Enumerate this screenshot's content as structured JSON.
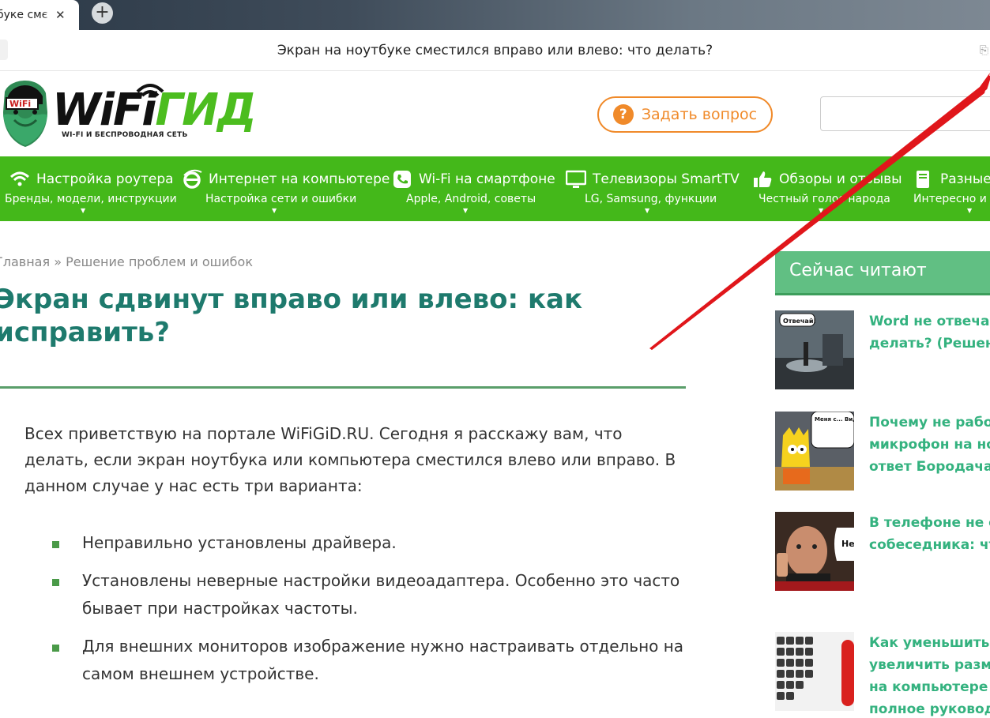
{
  "browser": {
    "tab_title": "букe смє",
    "tab_close": "✕",
    "new_tab": "+",
    "page_title": "Экран на ноутбуке сместился вправо или влево: что делать?"
  },
  "header": {
    "logo_main_black": "WiFi",
    "logo_main_green": "ГИД",
    "logo_badge": "WiFi",
    "logo_tagline": "WI-FI И БЕСПРОВОДНАЯ СЕТЬ",
    "ask_label": "Задать вопрос",
    "ask_icon": "?"
  },
  "nav": [
    {
      "title": "Настройка роутера",
      "sub": "Бренды, модели, инструкции",
      "icon": "wifi-icon"
    },
    {
      "title": "Интернет на компьютере",
      "sub": "Настройка сети и ошибки",
      "icon": "ie-icon"
    },
    {
      "title": "Wi-Fi на смартфоне",
      "sub": "Apple, Android, советы",
      "icon": "phone-icon"
    },
    {
      "title": "Телевизоры SmartTV",
      "sub": "LG, Samsung, функции",
      "icon": "monitor-icon"
    },
    {
      "title": "Обзоры и отзывы",
      "sub": "Честный голос народа",
      "icon": "thumbs-up-icon"
    },
    {
      "title": "Разные",
      "sub": "Интересно и п",
      "icon": "book-icon"
    }
  ],
  "nav_caret": "▼",
  "content": {
    "breadcrumb_home": "Главная",
    "breadcrumb_sep": " » ",
    "breadcrumb_section": "Решение проблем и ошибок",
    "heading": "Экран сдвинут вправо или влево: как исправить?",
    "intro": "Всех приветствую на портале WiFiGiD.RU. Сегодня я расскажу вам, что делать, если экран ноутбука или компьютера сместился влево или вправо. В данном случае у нас есть три варианта:",
    "bullets": [
      "Неправильно установлены драйвера.",
      "Установлены неверные настройки видеоадаптера. Особенно это часто бывает при настройках частоты.",
      "Для внешних мониторов изображение нужно настраивать отдельно на самом внешнем устройстве."
    ]
  },
  "sidebar": {
    "title": "Сейчас читают",
    "items": [
      {
        "lines": [
          "Word не отвечае",
          "делать? (Решено"
        ],
        "thumb_text": "Отвечай!"
      },
      {
        "lines": [
          "Почему не работ",
          "микрофон на ноу",
          "ответ Бородача"
        ],
        "thumb_text": "Меня с... Видимо у... с микро..."
      },
      {
        "lines": [
          "В телефоне не сл",
          "собеседника: что"
        ],
        "thumb_text": "Не"
      },
      {
        "lines": [
          "Как уменьшить и",
          "увеличить разме",
          "на компьютере с",
          "полное руковод"
        ],
        "thumb_text": ""
      }
    ]
  },
  "colors": {
    "nav_green": "#44b81a",
    "heading_teal": "#1e7a6d",
    "ask_orange": "#f08a2a",
    "sidebar_green": "#61bf83",
    "link_green": "#34b27f",
    "arrow_red": "#e0161b"
  }
}
